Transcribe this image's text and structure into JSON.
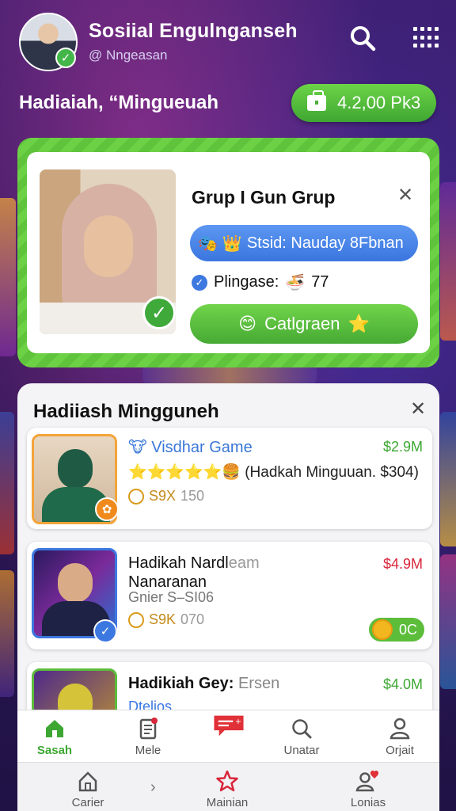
{
  "header": {
    "title": "Sosiial Engulnganseh",
    "handle": "@ Nngeasan",
    "greeting": "Hadiaiah, “Mingueuah",
    "balance": "4.2,00 Pk3"
  },
  "featured": {
    "title": "Grup I Gun Grup",
    "status": "Stsid: Nauday 8Fbnan",
    "players_label": "Plingase:",
    "players_count": "77",
    "cta_label": "Catlgraen"
  },
  "weekly": {
    "title": "Hadiiash Mingguneh",
    "items": [
      {
        "name": "Visdhar Game",
        "price": "$2.9M",
        "line2": "(Hadkah Minguuan. $304)",
        "coin_label": "S9X",
        "coin_value": "150"
      },
      {
        "name": "Hadikah Nardl",
        "name_suffix": "eam",
        "name_line2": "Nanaranan",
        "price": "$4.9M",
        "sub": "Gnier S–SI06",
        "coin_label": "S9K",
        "coin_value": "070",
        "pill_label": "0C"
      },
      {
        "name": "Hadikiah Gey:",
        "name_suffix": "Ersen",
        "price": "$4.0M",
        "sub": "Dtelios"
      }
    ]
  },
  "nav_primary": [
    {
      "label": "Sasah",
      "icon": "home-icon",
      "active": true
    },
    {
      "label": "Mele",
      "icon": "document-icon",
      "active": false
    },
    {
      "label": "",
      "icon": "message-icon",
      "active": false
    },
    {
      "label": "Unatar",
      "icon": "search-icon",
      "active": false
    },
    {
      "label": "Orjait",
      "icon": "person-icon",
      "active": false
    }
  ],
  "nav_secondary": [
    {
      "label": "Carier",
      "icon": "home-outline-icon"
    },
    {
      "label": "Mainian",
      "icon": "star-icon"
    },
    {
      "label": "Lonias",
      "icon": "user-heart-icon"
    }
  ],
  "colors": {
    "green": "#4caf3a",
    "blue": "#3c78e0",
    "price_green": "#3ea733",
    "price_red": "#d8263a"
  }
}
